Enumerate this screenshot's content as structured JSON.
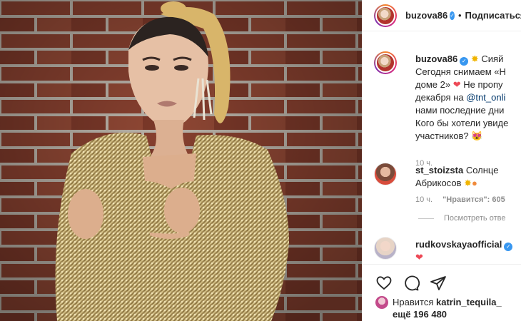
{
  "post": {
    "author": "buzova86",
    "follow_label": "Подписаться",
    "separator": "•"
  },
  "caption": {
    "author": "buzova86",
    "sparkle_icon": "sparkle-icon",
    "lines": [
      "Сияй",
      "Сегодня снимаем «Н",
      "доме 2»",
      "Не пропу",
      "декабря на",
      "@tnt_onli",
      "нами последние дни",
      "Кого бы хотели увиде",
      "участников?"
    ],
    "time": "10 ч."
  },
  "comments": [
    {
      "author": "st_stoizsta",
      "text_1": "Солнце",
      "text_2": "Абрикосов",
      "time": "10 ч.",
      "likes": "\"Нравится\": 605",
      "replies": "Посмотреть отве"
    },
    {
      "author": "rudkovskayaofficial",
      "text_1": "❤"
    }
  ],
  "likes_bar": {
    "prefix": "Нравится",
    "user": "katrin_tequila_",
    "more": "ещё 196 480"
  },
  "icons": [
    "heart-icon",
    "comment-icon",
    "share-icon",
    "verified-icon"
  ],
  "colors": {
    "verified": "#3897f0",
    "heart": "#ed4956",
    "link": "#00376b",
    "muted": "#8e8e8e"
  }
}
